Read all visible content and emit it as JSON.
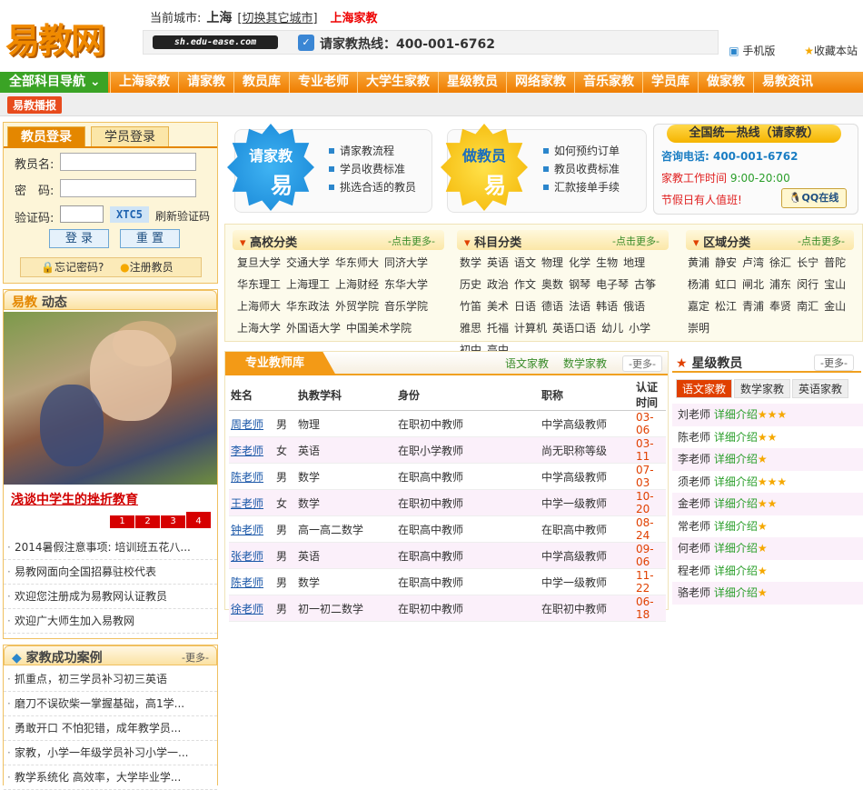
{
  "logo": {
    "text": "易教网"
  },
  "header": {
    "current_city_label": "当前城市:",
    "city": "上海",
    "switch_city": "[切换其它城市]",
    "region_link": "上海家教",
    "url": "sh.edu-ease.com",
    "hotline": "请家教热线：400-001-6762",
    "mobile": "手机版",
    "bookmark": "收藏本站"
  },
  "nav": {
    "all": "全部科目导航",
    "items": [
      "上海家教",
      "请家教",
      "教员库",
      "专业老师",
      "大学生家教",
      "星级教员",
      "网络家教",
      "音乐家教",
      "学员库",
      "做家教",
      "易教资讯"
    ]
  },
  "subbar": {
    "label": "易教播报"
  },
  "login": {
    "tab_teacher": "教员登录",
    "tab_student": "学员登录",
    "username_label": "教员名:",
    "password_label": "密　码:",
    "captcha_label": "验证码:",
    "captcha_code": "XTC5",
    "refresh": "刷新验证码",
    "login_btn": "登 录",
    "reset_btn": "重 置",
    "forgot": "忘记密码?",
    "register": "注册教员"
  },
  "dynamics": {
    "title_brand": "易教",
    "title_rest": " 动态",
    "caption": "浅谈中学生的挫折教育",
    "pages": [
      "1",
      "2",
      "3",
      "4"
    ],
    "list": [
      "2014暑假注意事项: 培训班五花八...",
      "易教网面向全国招募驻校代表",
      "欢迎您注册成为易教网认证教员",
      "欢迎广大师生加入易教网"
    ]
  },
  "cases": {
    "title": "家教成功案例",
    "more": "更多",
    "list": [
      "抓重点，初三学员补习初三英语",
      "磨刀不误砍柴一掌握基础，高1学...",
      "勇敢开口 不怕犯错，成年教学员...",
      "家教，小学一年级学员补习小学一...",
      "教学系统化 高效率，大学毕业学..."
    ]
  },
  "promo1": {
    "badge": "请家教",
    "yi": "易",
    "items": [
      "请家教流程",
      "学员收费标准",
      "挑选合适的教员"
    ]
  },
  "promo2": {
    "badge": "做教员",
    "yi": "易",
    "items": [
      "如何预约订单",
      "教员收费标准",
      "汇款接单手续"
    ]
  },
  "hotline_box": {
    "title": "全国统一热线（请家教）",
    "consult": "咨询电话: 400-001-6762",
    "hours_label": "家教工作时间",
    "hours": "9:00-20:00",
    "holiday": "节假日有人值班!",
    "qq": "QQ在线"
  },
  "categories": [
    {
      "title": "高校分类",
      "more": "-点击更多-",
      "items": [
        "复旦大学",
        "交通大学",
        "华东师大",
        "同济大学",
        "华东理工",
        "上海理工",
        "上海财经",
        "东华大学",
        "上海师大",
        "华东政法",
        "外贸学院",
        "音乐学院",
        "上海大学",
        "外国语大学",
        "中国美术学院"
      ]
    },
    {
      "title": "科目分类",
      "more": "-点击更多-",
      "items": [
        "数学",
        "英语",
        "语文",
        "物理",
        "化学",
        "生物",
        "地理",
        "历史",
        "政治",
        "作文",
        "奥数",
        "钢琴",
        "电子琴",
        "古筝",
        "竹笛",
        "美术",
        "日语",
        "德语",
        "法语",
        "韩语",
        "俄语",
        "雅思",
        "托福",
        "计算机",
        "英语口语",
        "幼儿",
        "小学",
        "初中",
        "高中"
      ]
    },
    {
      "title": "区域分类",
      "more": "-点击更多-",
      "items": [
        "黄浦",
        "静安",
        "卢湾",
        "徐汇",
        "长宁",
        "普陀",
        "杨浦",
        "虹口",
        "闸北",
        "浦东",
        "闵行",
        "宝山",
        "嘉定",
        "松江",
        "青浦",
        "奉贤",
        "南汇",
        "金山",
        "崇明"
      ]
    }
  ],
  "teachers": {
    "title": "专业教师库",
    "sub1": "语文家教",
    "sub2": "数学家教",
    "more": "更多",
    "columns": [
      "姓名",
      "执教学科",
      "身份",
      "职称",
      "认证时间"
    ],
    "rows": [
      [
        "周老师",
        "男",
        "物理",
        "在职初中教师",
        "中学高级教师",
        "03-06"
      ],
      [
        "李老师",
        "女",
        "英语",
        "在职小学教师",
        "尚无职称等级",
        "03-11"
      ],
      [
        "陈老师",
        "男",
        "数学",
        "在职高中教师",
        "中学高级教师",
        "07-03"
      ],
      [
        "王老师",
        "女",
        "数学",
        "在职初中教师",
        "中学一级教师",
        "10-20"
      ],
      [
        "钟老师",
        "男",
        "高一高二数学",
        "在职高中教师",
        "在职高中教师",
        "08-24"
      ],
      [
        "张老师",
        "男",
        "英语",
        "在职高中教师",
        "中学高级教师",
        "09-06"
      ],
      [
        "陈老师",
        "男",
        "数学",
        "在职高中教师",
        "中学一级教师",
        "11-22"
      ],
      [
        "徐老师",
        "男",
        "初一初二数学",
        "在职初中教师",
        "在职初中教师",
        "06-18"
      ]
    ]
  },
  "star_teachers": {
    "title": "星级教员",
    "more": "更多",
    "tabs": [
      "语文家教",
      "数学家教",
      "英语家教"
    ],
    "detail": "详细介绍",
    "list": [
      {
        "name": "刘老师",
        "stars": "★★★"
      },
      {
        "name": "陈老师",
        "stars": "★★"
      },
      {
        "name": "李老师",
        "stars": "★"
      },
      {
        "name": "须老师",
        "stars": "★★★"
      },
      {
        "name": "金老师",
        "stars": "★★"
      },
      {
        "name": "常老师",
        "stars": "★"
      },
      {
        "name": "何老师",
        "stars": "★"
      },
      {
        "name": "程老师",
        "stars": "★"
      },
      {
        "name": "骆老师",
        "stars": "★"
      }
    ]
  }
}
